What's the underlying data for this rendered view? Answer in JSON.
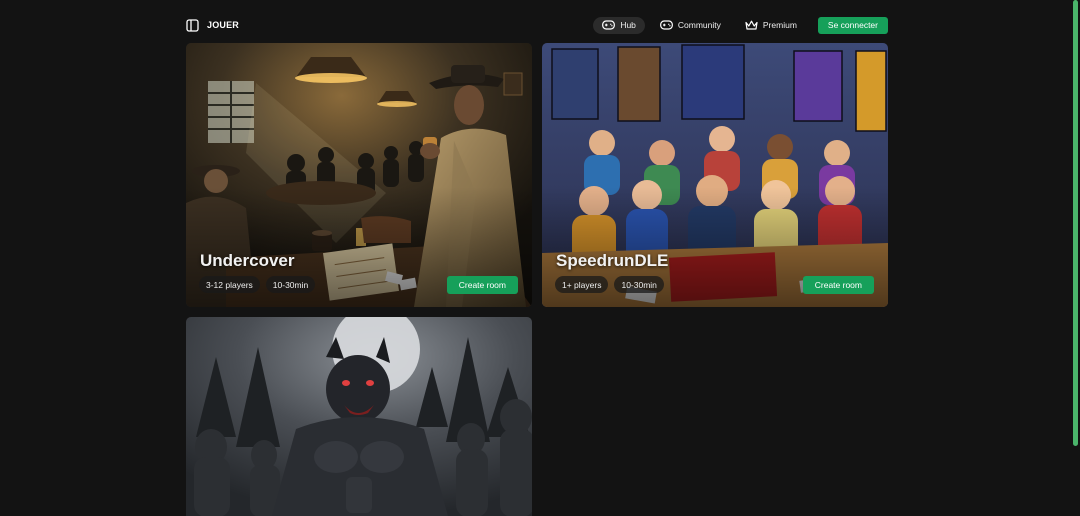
{
  "header": {
    "brand": "JOUER",
    "nav": [
      {
        "label": "Hub",
        "icon": "gamepad-icon",
        "active": true
      },
      {
        "label": "Community",
        "icon": "gamepad-icon",
        "active": false
      },
      {
        "label": "Premium",
        "icon": "crown-icon",
        "active": false
      }
    ],
    "login_label": "Se connecter"
  },
  "cards": [
    {
      "title": "Undercover",
      "players": "3-12 players",
      "duration": "10-30min",
      "button": "Create room"
    },
    {
      "title": "SpeedrunDLE",
      "players": "1+ players",
      "duration": "10-30min",
      "button": "Create room"
    },
    {
      "title": "",
      "players": "",
      "duration": "",
      "button": ""
    }
  ],
  "colors": {
    "background": "#131313",
    "accent": "#16a05a",
    "scrollbar": "#4bb56b"
  }
}
